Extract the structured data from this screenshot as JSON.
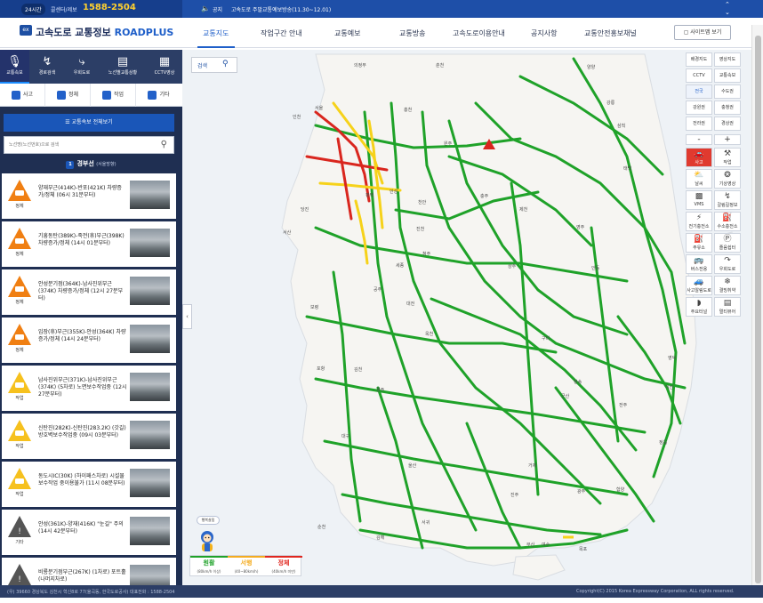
{
  "topbar": {
    "badge_24h": "24시간",
    "call_label": "콜센터/제보",
    "call_number": "1588-2504",
    "notice_label": "공지",
    "notice_text": "고속도로 주말교통예보방송(11.30~12.01)"
  },
  "header": {
    "logo_text": "고속도로 교통정보",
    "logo_en": "ROADPLUS",
    "nav": [
      "교통지도",
      "작업구간 안내",
      "교통예보",
      "교통방송",
      "고속도로이용안내",
      "공지사항",
      "교통안전홍보채널"
    ],
    "active_nav": "교통지도",
    "sitemap_label": "사이트맵 보기"
  },
  "left_tabs": [
    "교통속보",
    "경로검색",
    "우회도로",
    "노선별교통상황",
    "CCTV영상"
  ],
  "sub_tabs": [
    "사고",
    "정체",
    "작업",
    "기타"
  ],
  "list": {
    "all_button": "교통속보 전체보기",
    "search_placeholder": "노선명(노선번호)으로 검색",
    "route_badge": "1",
    "route_name": "경부선",
    "route_dir": "(서울방향)",
    "items": [
      {
        "kind": "정체",
        "title": "양재부근(414K)-반포(421K) 차량증가/정체 (06시 31분부터)",
        "color": "#f07f12"
      },
      {
        "kind": "정체",
        "title": "기흥동탄(389K)-죽전(휴)부근(398K) 차량증가/정체 (14시 01분부터)",
        "color": "#f07f12"
      },
      {
        "kind": "정체",
        "title": "안성분기점(364K)-남사진위부근(374K) 차량증가/정체 (12시 27분부터)",
        "color": "#f07f12"
      },
      {
        "kind": "정체",
        "title": "입장(휴)부근(355K)-안성(364K) 차량증가/정체 (14시 24분부터)",
        "color": "#f07f12"
      },
      {
        "kind": "작업",
        "title": "남사진위부근(371K)-남사진위부근(374K) (5차로) 노면보수작업중 (12시 27분부터)",
        "color": "#f6c11e"
      },
      {
        "kind": "작업",
        "title": "신탄진(282K)-신탄진(283.2K) (갓길) 방호벽보수작업중 (09시 03분부터)",
        "color": "#f6c11e"
      },
      {
        "kind": "작업",
        "title": "동도시IC(30K) (하이패스차로) 시설물보수작업 중이용불가 (11시 08분부터)",
        "color": "#f6c11e"
      },
      {
        "kind": "기타",
        "title": "안성(361K)-양재(416K) \"눈길\" 주의 (14시 42분부터)",
        "color": "#555555"
      },
      {
        "kind": "기타",
        "title": "비룡분기점부근(267K) (1차로) 포트홀(나머지차로)",
        "color": "#555555"
      }
    ]
  },
  "map": {
    "search_label": "검색",
    "cities": [
      "의정부",
      "춘천",
      "양양",
      "강릉",
      "서울",
      "홍천",
      "인천",
      "원주",
      "삼척",
      "평택",
      "태백",
      "충주",
      "안성",
      "천안",
      "당진",
      "진천",
      "서산",
      "제천",
      "청주",
      "영주",
      "세종",
      "안동",
      "공주",
      "대전",
      "보령",
      "상주",
      "옥천",
      "구미",
      "청송",
      "영덕",
      "포항",
      "군산",
      "김천",
      "익산",
      "경주",
      "전주",
      "대구",
      "정읍",
      "울산",
      "함양",
      "광주",
      "진주",
      "김해",
      "부산",
      "목포",
      "순천",
      "여수",
      "서귀",
      "거제"
    ]
  },
  "right_panel": {
    "top": [
      [
        "배경지도",
        "영상지도"
      ],
      [
        "CCTV",
        "교통속보"
      ],
      [
        "전국",
        "수도권"
      ],
      [
        "강원권",
        "충청권"
      ],
      [
        "전라권",
        "경상권"
      ]
    ],
    "selected_top": "전국",
    "zoom_out": "-",
    "zoom_in": "+",
    "overlay": [
      [
        "사고",
        "작업"
      ],
      [
        "날씨",
        "기상영상"
      ],
      [
        "VMS",
        "갈림길정보"
      ],
      [
        "전기충전소",
        "수소충전소"
      ],
      [
        "주유소",
        "졸음쉼터"
      ],
      [
        "버스전용",
        "우회도로"
      ],
      [
        "사고알림도로",
        "결빙취약"
      ],
      [
        "주요터널",
        "멀티뷰어"
      ]
    ],
    "selected_overlay": "사고"
  },
  "legend": {
    "items": [
      {
        "name": "원활",
        "speed": "(80km/h 이상)",
        "color": "#1fa229"
      },
      {
        "name": "서행",
        "speed": "(40~80km/h)",
        "color": "#f4ac20"
      },
      {
        "name": "정체",
        "speed": "(40km/h 미만)",
        "color": "#e0271f"
      }
    ],
    "mascot_label": "행복살림"
  },
  "footer": {
    "left": "(우) 39660 경상북도 김천시 혁신8로 77(율곡동, 한국도로공사) 대표전화 : 1588-2504",
    "right": "Copyright(C) 2015 Korea Expressway Corporation, ALL rights reserved."
  }
}
